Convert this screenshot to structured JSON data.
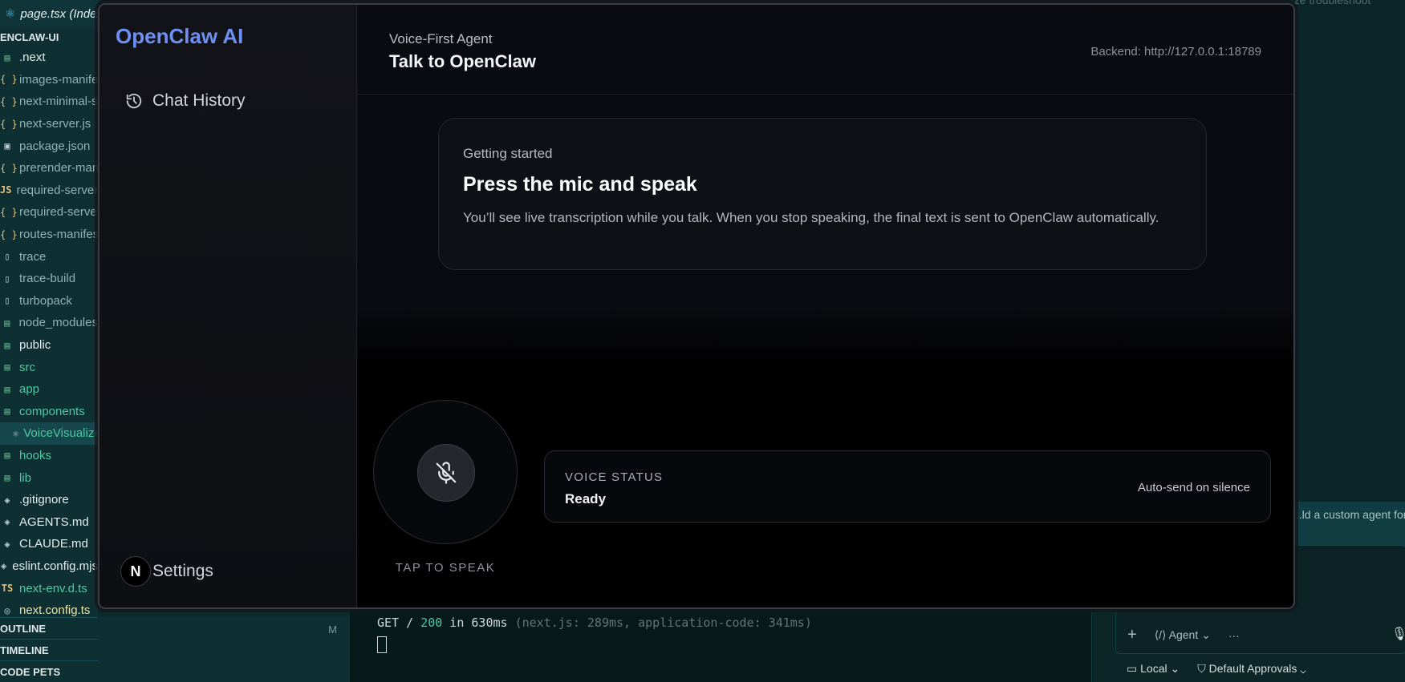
{
  "editor": {
    "tab_title": "page.tsx (Index)",
    "explorer_root": "ENCLAW-UI",
    "files": [
      {
        "label": ".next",
        "kind": "folder-white"
      },
      {
        "label": "images-manifest.json",
        "kind": "json"
      },
      {
        "label": "next-minimal-server.js",
        "kind": "json"
      },
      {
        "label": "next-server.js",
        "kind": "json"
      },
      {
        "label": "package.json",
        "kind": "pkg"
      },
      {
        "label": "prerender-manifest.json",
        "kind": "json"
      },
      {
        "label": "required-server-files.js",
        "kind": "js"
      },
      {
        "label": "required-server-files.json",
        "kind": "json"
      },
      {
        "label": "routes-manifest.json",
        "kind": "json"
      },
      {
        "label": "trace",
        "kind": "file"
      },
      {
        "label": "trace-build",
        "kind": "file"
      },
      {
        "label": "turbopack",
        "kind": "file"
      },
      {
        "label": "node_modules",
        "kind": "folder-dim"
      },
      {
        "label": "public",
        "kind": "folder-white"
      },
      {
        "label": "src",
        "kind": "folder-green"
      },
      {
        "label": "app",
        "kind": "folder-green"
      },
      {
        "label": "components",
        "kind": "folder-green"
      },
      {
        "label": "VoiceVisualizer.tsx",
        "kind": "react-selected"
      },
      {
        "label": "hooks",
        "kind": "folder-green"
      },
      {
        "label": "lib",
        "kind": "folder-green"
      },
      {
        "label": ".gitignore",
        "kind": "file-white"
      },
      {
        "label": "AGENTS.md",
        "kind": "file-white"
      },
      {
        "label": "CLAUDE.md",
        "kind": "file-white"
      },
      {
        "label": "eslint.config.mjs",
        "kind": "file-white"
      },
      {
        "label": "next-env.d.ts",
        "kind": "ts"
      },
      {
        "label": "next.config.ts",
        "kind": "file-yellow"
      }
    ],
    "bottom_sections": [
      "OUTLINE",
      "TIMELINE",
      "CODE PETS"
    ],
    "modified_marker": "M",
    "terminal": {
      "method_path": "GET / ",
      "status": "200",
      "timing": " in 630ms ",
      "detail": "(next.js: 289ms, application-code: 341ms)"
    },
    "chat": {
      "top_fragment": "...ze troubleshoot",
      "suggestion": "...ld a custom agent for",
      "mode_label": "Agent",
      "more_label": "···",
      "location_label": "Local",
      "approvals_label": "Default Approvals"
    }
  },
  "app": {
    "brand": "OpenClaw AI",
    "nav": {
      "history_label": "Chat History",
      "settings_label": "Settings",
      "avatar_letter": "N"
    },
    "header": {
      "subtitle": "Voice-First Agent",
      "title": "Talk to OpenClaw",
      "backend": "Backend: http://127.0.0.1:18789"
    },
    "intro_card": {
      "eyebrow": "Getting started",
      "heading": "Press the mic and speak",
      "body": "You’ll see live transcription while you talk. When you stop speaking, the final text is sent to OpenClaw automatically."
    },
    "mic": {
      "tap_label": "TAP TO SPEAK",
      "icon": "mic-off-icon"
    },
    "voice_status": {
      "label": "VOICE STATUS",
      "value": "Ready",
      "mode": "Auto-send on silence"
    },
    "colors": {
      "brand": "#6f8ff1",
      "window_bg": "#09090d",
      "ok_green": "#4ec9a0"
    }
  }
}
